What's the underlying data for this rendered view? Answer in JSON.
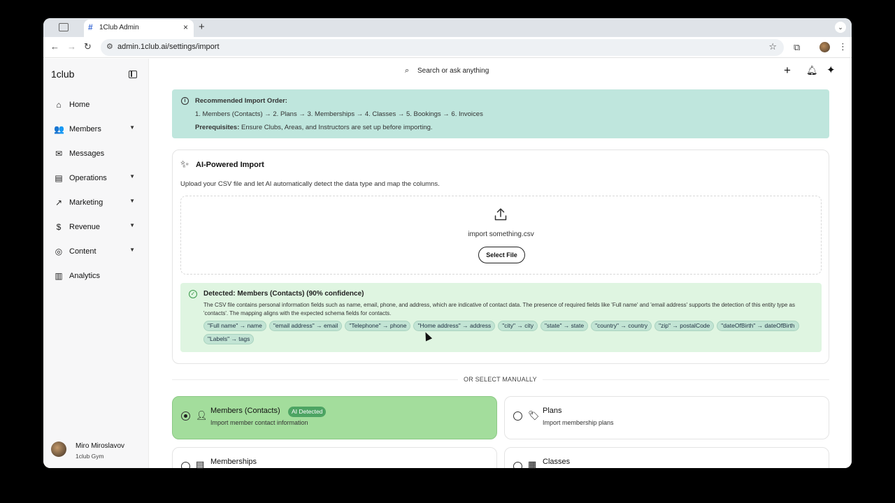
{
  "browser": {
    "tab_title": "1Club Admin",
    "url": "admin.1club.ai/settings/import",
    "new_tab_glyph": "+",
    "close_glyph": "×"
  },
  "sidebar": {
    "brand": "1club",
    "items": [
      {
        "label": "Home",
        "icon": "home-icon",
        "expandable": false
      },
      {
        "label": "Members",
        "icon": "users-icon",
        "expandable": true
      },
      {
        "label": "Messages",
        "icon": "mail-icon",
        "expandable": false
      },
      {
        "label": "Operations",
        "icon": "clipboard-icon",
        "expandable": true
      },
      {
        "label": "Marketing",
        "icon": "trend-icon",
        "expandable": true
      },
      {
        "label": "Revenue",
        "icon": "dollar-icon",
        "expandable": true
      },
      {
        "label": "Content",
        "icon": "globe-icon",
        "expandable": true
      },
      {
        "label": "Analytics",
        "icon": "chart-icon",
        "expandable": false
      }
    ],
    "user": {
      "name": "Miro Miroslavov",
      "org": "1club Gym"
    }
  },
  "topbar": {
    "search_placeholder": "Search or ask anything"
  },
  "info": {
    "title": "Recommended Import Order:",
    "order": "1. Members (Contacts) → 2. Plans → 3. Memberships → 4. Classes → 5. Bookings → 6. Invoices",
    "prereq_label": "Prerequisites:",
    "prereq_text": " Ensure Clubs, Areas, and Instructors are set up before importing."
  },
  "ai_import": {
    "title": "AI-Powered Import",
    "description": "Upload your CSV file and let AI automatically detect the data type and map the columns.",
    "file_name": "import something.csv",
    "select_button": "Select File",
    "detected_title": "Detected: Members (Contacts) (90% confidence)",
    "detected_text": "The CSV file contains personal information fields such as name, email, phone, and address, which are indicative of contact data. The presence of required fields like 'Full name' and 'email address' supports the detection of this entity type as 'contacts'. The mapping aligns with the expected schema fields for contacts.",
    "mappings": [
      "\"Full name\" → name",
      "\"email address\" → email",
      "\"Telephone\" → phone",
      "\"Home address\" → address",
      "\"city\" → city",
      "\"state\" → state",
      "\"country\" → country",
      "\"zip\" → postalCode",
      "\"dateOfBirth\" → dateOfBirth",
      "\"Labels\" → tags"
    ]
  },
  "manual": {
    "divider_label": "OR SELECT MANUALLY",
    "options": [
      {
        "title": "Members (Contacts)",
        "desc": "Import member contact information",
        "badge": "AI Detected",
        "selected": true
      },
      {
        "title": "Plans",
        "desc": "Import membership plans",
        "selected": false
      },
      {
        "title": "Memberships",
        "desc": "",
        "selected": false
      },
      {
        "title": "Classes",
        "desc": "",
        "selected": false
      }
    ]
  },
  "colors": {
    "info_bg": "#bfe6dd",
    "detect_bg": "#dff5e1",
    "selected_bg": "#a3dd9c",
    "badge_bg": "#4da463"
  }
}
